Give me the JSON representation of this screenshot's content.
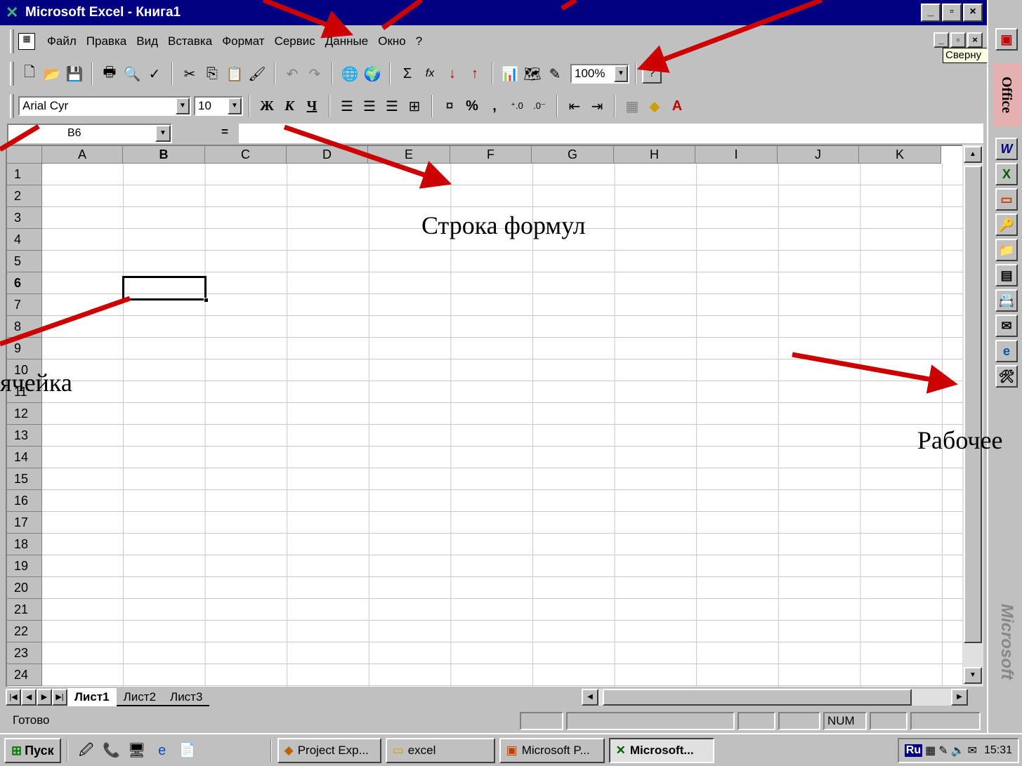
{
  "window": {
    "title": "Microsoft Excel - Книга1",
    "controls": {
      "minimize": "_",
      "maximize": "▫",
      "close": "×"
    }
  },
  "menu": {
    "items": [
      "Файл",
      "Правка",
      "Вид",
      "Вставка",
      "Формат",
      "Сервис",
      "Данные",
      "Окно",
      "?"
    ]
  },
  "toolbar": {
    "zoom": "100%",
    "font_name": "Arial Cyr",
    "font_size": "10",
    "bold_label": "Ж",
    "italic_label": "К",
    "underline_label": "Ч",
    "percent_label": "%",
    "comma_label": ",",
    "autosum_label": "Σ",
    "function_label": "fx"
  },
  "formula_bar": {
    "name_box": "B6",
    "equals": "=",
    "value": ""
  },
  "grid": {
    "columns": [
      "A",
      "B",
      "C",
      "D",
      "E",
      "F",
      "G",
      "H",
      "I",
      "J",
      "K"
    ],
    "rows": [
      "1",
      "2",
      "3",
      "4",
      "5",
      "6",
      "7",
      "8",
      "9",
      "10",
      "11",
      "12",
      "13",
      "14",
      "15",
      "16",
      "17",
      "18",
      "19",
      "20",
      "21",
      "22",
      "23",
      "24"
    ],
    "selected_column": "B",
    "selected_row": "6"
  },
  "sheets": {
    "tabs": [
      "Лист1",
      "Лист2",
      "Лист3"
    ],
    "active": "Лист1"
  },
  "status": {
    "left": "Готово",
    "num": "NUM"
  },
  "taskbar": {
    "start": "Пуск",
    "tasks": [
      "Project Exp...",
      "excel",
      "Microsoft P...",
      "Microsoft..."
    ],
    "active_task": "Microsoft...",
    "lang": "Ru",
    "clock": "15:31"
  },
  "office_bar": {
    "label": "Office",
    "brand": "Microsoft",
    "tooltip": "Сверну"
  },
  "annotations": {
    "formula_bar": "Строка формул",
    "cell": "ячейка",
    "workspace": "Рабочее"
  },
  "colors": {
    "title_bar": "#000080",
    "arrow": "#cc0000",
    "office_label_bg": "#e4b0b0"
  }
}
